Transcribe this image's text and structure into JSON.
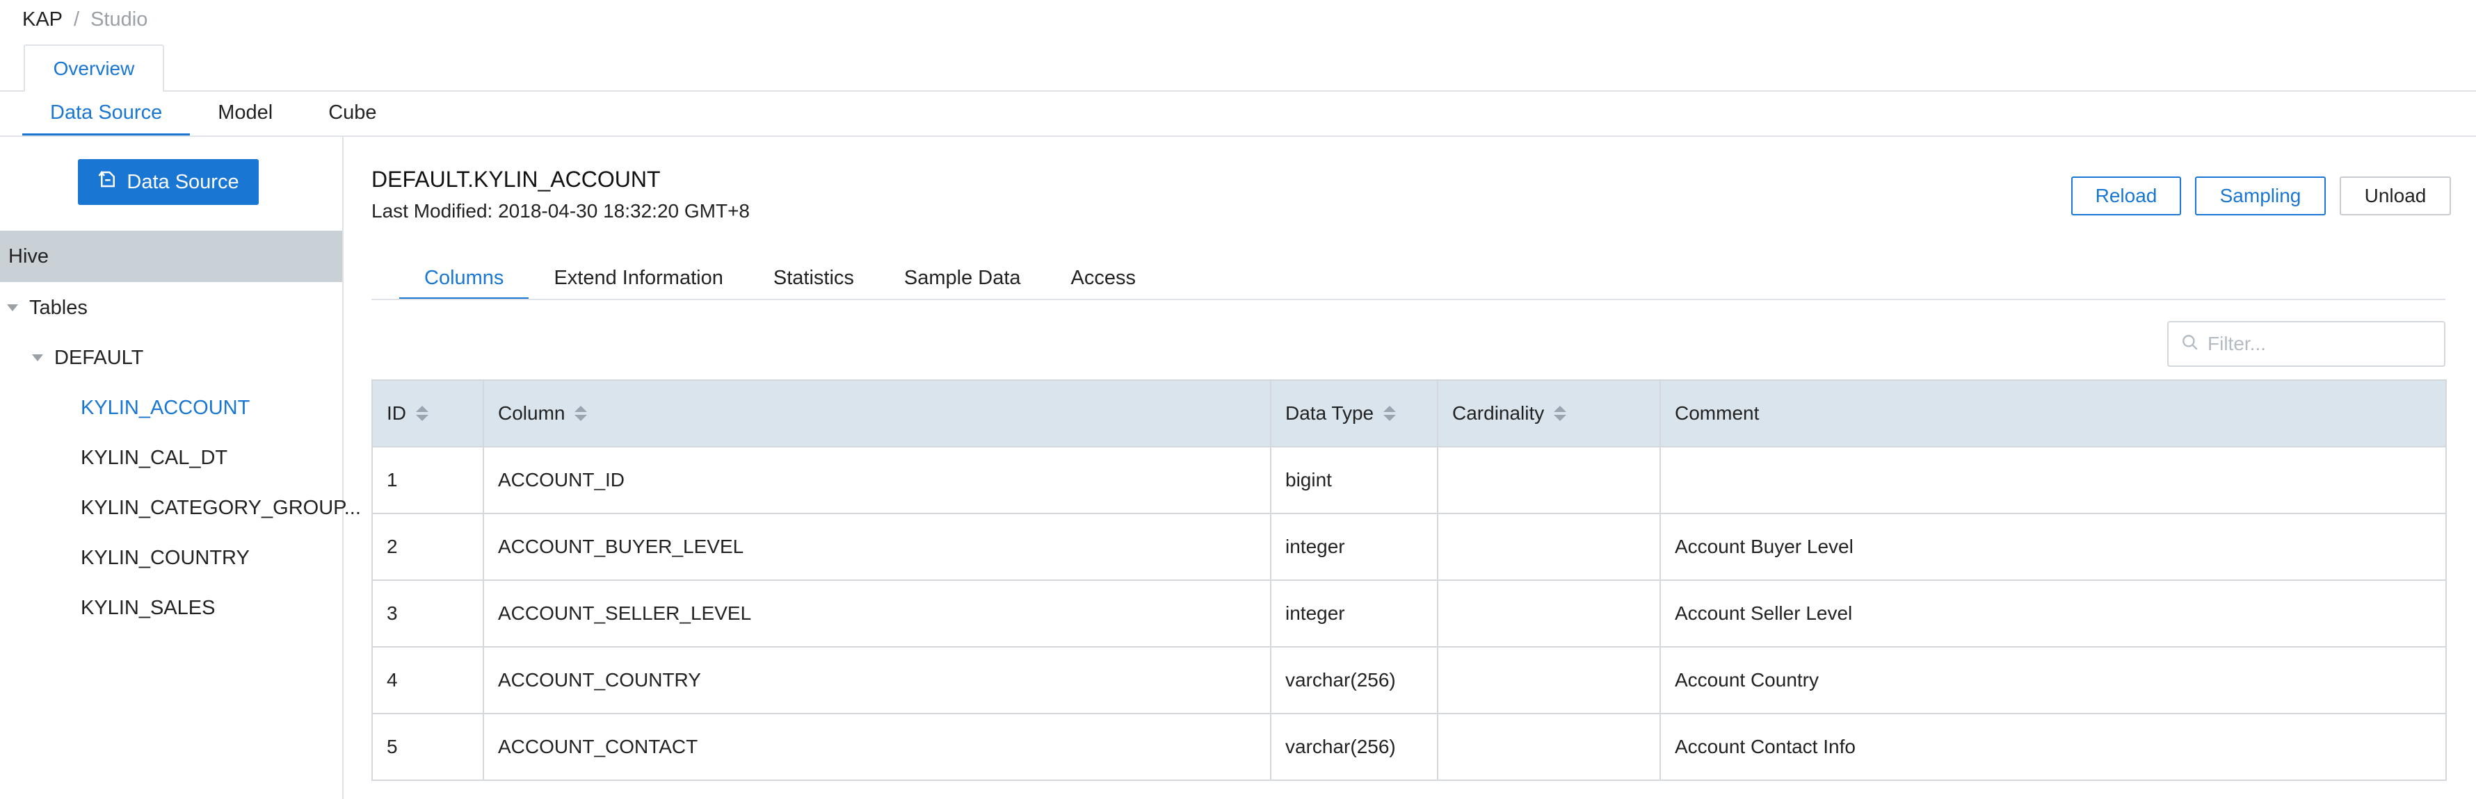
{
  "breadcrumb": {
    "root": "KAP",
    "separator": "/",
    "current": "Studio"
  },
  "top_tabs": [
    {
      "label": "Overview",
      "active": true
    }
  ],
  "section_tabs": [
    {
      "label": "Data Source",
      "active": true
    },
    {
      "label": "Model",
      "active": false
    },
    {
      "label": "Cube",
      "active": false
    }
  ],
  "sidebar": {
    "add_button_label": "Data Source",
    "source_header": "Hive",
    "tree": {
      "tables_label": "Tables",
      "database_label": "DEFAULT",
      "tables": [
        {
          "label": "KYLIN_ACCOUNT",
          "selected": true
        },
        {
          "label": "KYLIN_CAL_DT",
          "selected": false
        },
        {
          "label": "KYLIN_CATEGORY_GROUP...",
          "selected": false
        },
        {
          "label": "KYLIN_COUNTRY",
          "selected": false
        },
        {
          "label": "KYLIN_SALES",
          "selected": false
        }
      ]
    }
  },
  "detail": {
    "title": "DEFAULT.KYLIN_ACCOUNT",
    "last_modified": "Last Modified: 2018-04-30 18:32:20 GMT+8",
    "actions": {
      "reload": "Reload",
      "sampling": "Sampling",
      "unload": "Unload"
    },
    "tabs": [
      {
        "label": "Columns",
        "active": true
      },
      {
        "label": "Extend Information",
        "active": false
      },
      {
        "label": "Statistics",
        "active": false
      },
      {
        "label": "Sample Data",
        "active": false
      },
      {
        "label": "Access",
        "active": false
      }
    ],
    "filter_placeholder": "Filter...",
    "table": {
      "headers": [
        "ID",
        "Column",
        "Data Type",
        "Cardinality",
        "Comment"
      ],
      "rows": [
        [
          "1",
          "ACCOUNT_ID",
          "bigint",
          "",
          ""
        ],
        [
          "2",
          "ACCOUNT_BUYER_LEVEL",
          "integer",
          "",
          "Account Buyer Level"
        ],
        [
          "3",
          "ACCOUNT_SELLER_LEVEL",
          "integer",
          "",
          "Account Seller Level"
        ],
        [
          "4",
          "ACCOUNT_COUNTRY",
          "varchar(256)",
          "",
          "Account Country"
        ],
        [
          "5",
          "ACCOUNT_CONTACT",
          "varchar(256)",
          "",
          "Account Contact Info"
        ]
      ]
    }
  },
  "colors": {
    "accent": "#1976d2",
    "header_bg": "#d9e4ec",
    "source_header_bg": "#c9d0d6"
  }
}
